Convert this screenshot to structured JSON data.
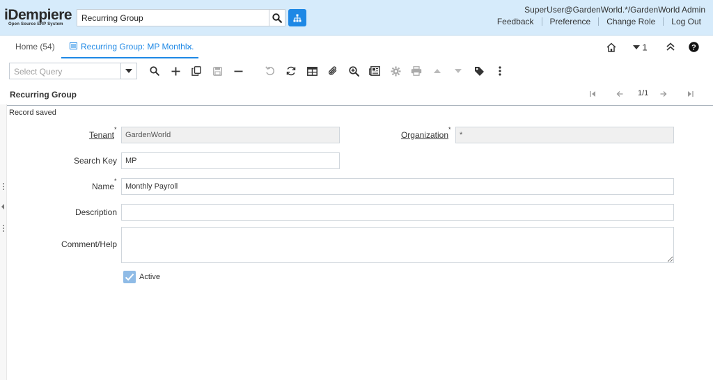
{
  "header": {
    "logo_main": "iDempiere",
    "logo_sub": "Open Source ERP System",
    "search_value": "Recurring Group",
    "user": "SuperUser@GardenWorld.*/GardenWorld Admin",
    "links": [
      "Feedback",
      "Preference",
      "Change Role",
      "Log Out"
    ]
  },
  "tabs": {
    "home": "Home (54)",
    "active": "Recurring Group: MP Monthl...",
    "window_count": "1"
  },
  "toolbar": {
    "query_placeholder": "Select Query"
  },
  "panel": {
    "title": "Recurring Group",
    "record_nav": "1/1",
    "status": "Record saved"
  },
  "form": {
    "tenant_label": "Tenant",
    "tenant_value": "GardenWorld",
    "org_label": "Organization",
    "org_value": "*",
    "search_key_label": "Search Key",
    "search_key_value": "MP",
    "name_label": "Name",
    "name_value": "Monthly Payroll",
    "description_label": "Description",
    "description_value": "",
    "comment_label": "Comment/Help",
    "comment_value": "",
    "active_label": "Active",
    "active_checked": true
  },
  "colors": {
    "header_bg": "#d6ebfb",
    "accent": "#1e88e5",
    "checkbox": "#8fbbe6"
  }
}
